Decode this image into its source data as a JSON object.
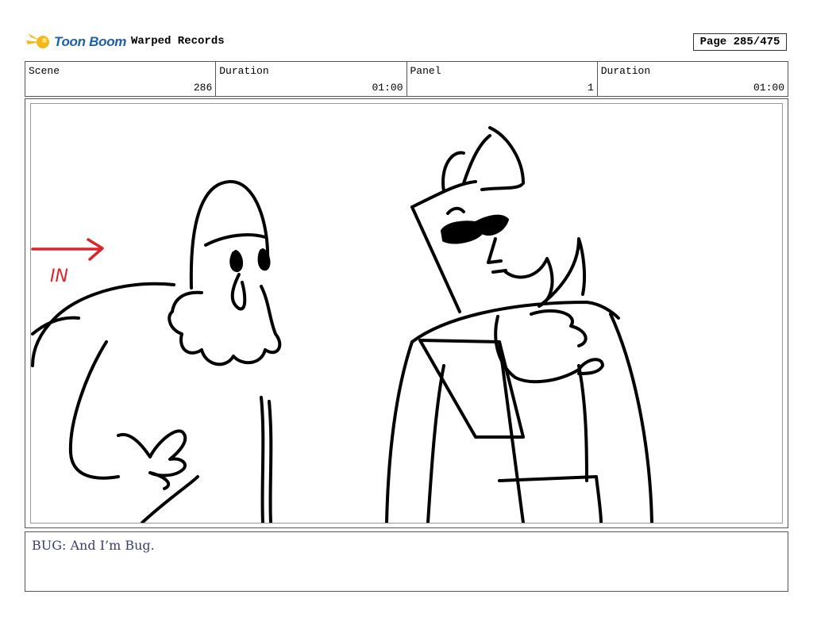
{
  "header": {
    "logo_text": "Toon Boom",
    "project_title": "Warped Records",
    "page_label": "Page 285/475"
  },
  "info": {
    "scene_label": "Scene",
    "scene_value": "286",
    "scene_duration_label": "Duration",
    "scene_duration_value": "01:00",
    "panel_label": "Panel",
    "panel_value": "1",
    "panel_duration_label": "Duration",
    "panel_duration_value": "01:00"
  },
  "panel": {
    "annotation_text": "IN",
    "annotation_color": "#d8262b"
  },
  "dialog": {
    "text": "BUG: And I’m Bug."
  },
  "colors": {
    "logo_blue": "#1f5fa8",
    "logo_yellow": "#f3b81c",
    "dialog_text": "#3a3f6e"
  }
}
